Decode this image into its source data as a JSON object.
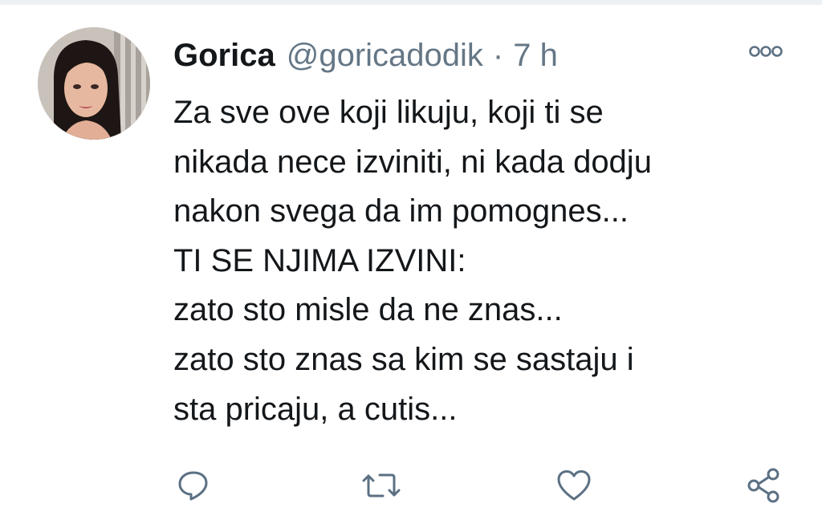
{
  "tweet": {
    "author_name": "Gorica",
    "author_handle": "@goricadodik",
    "separator": "·",
    "time_ago": "7 h",
    "text_lines": [
      "Za sve ove koji likuju, koji ti se",
      "nikada nece izviniti, ni kada dodju",
      "nakon svega da im pomognes...",
      "TI SE NJIMA IZVINI:",
      "zato sto misle da ne znas...",
      "zato sto znas sa kim se sastaju i",
      "sta pricaju, a cutis..."
    ]
  },
  "icons": {
    "more": "more-options-icon",
    "reply": "reply-icon",
    "retweet": "retweet-icon",
    "like": "heart-icon",
    "share": "share-icon"
  },
  "colors": {
    "text": "#14171a",
    "secondary": "#657786",
    "icon": "#5b7083",
    "background": "#ffffff"
  }
}
